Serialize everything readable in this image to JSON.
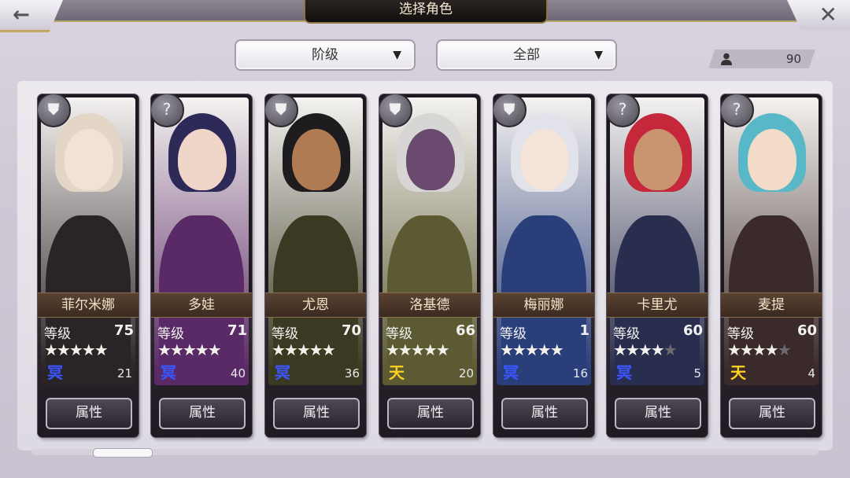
{
  "header": {
    "title": "选择角色",
    "back_icon": "←",
    "close_icon": "✕"
  },
  "filters": [
    {
      "label": "阶级",
      "caret": "▼"
    },
    {
      "label": "全部",
      "caret": "▼"
    }
  ],
  "roster_count": "90",
  "level_label": "等级",
  "attr_label": "属性",
  "characters": [
    {
      "name": "菲尔米娜",
      "level": "75",
      "stars": "★★★★★",
      "stars_off": "",
      "element": "冥",
      "element_color": "#3a56ff",
      "count": "21",
      "class_icon": "⛊",
      "hair": "#e3d6c6",
      "skin": "#f2e2d4",
      "outfit": "#2b2426"
    },
    {
      "name": "多娃",
      "level": "71",
      "stars": "★★★★★",
      "stars_off": "",
      "element": "冥",
      "element_color": "#3a56ff",
      "count": "40",
      "class_icon": "?",
      "hair": "#2e2a58",
      "skin": "#f0d6c8",
      "outfit": "#5a2a66"
    },
    {
      "name": "尤恩",
      "level": "70",
      "stars": "★★★★★",
      "stars_off": "",
      "element": "冥",
      "element_color": "#3a56ff",
      "count": "36",
      "class_icon": "⛊",
      "hair": "#1e1c1e",
      "skin": "#b07a52",
      "outfit": "#3a3a22"
    },
    {
      "name": "洛基德",
      "level": "66",
      "stars": "★★★★★",
      "stars_off": "",
      "element": "天",
      "element_color": "#ffd21e",
      "count": "20",
      "class_icon": "⛊",
      "hair": "#d8d6d4",
      "skin": "#6a4a6e",
      "outfit": "#5c5a32"
    },
    {
      "name": "梅丽娜",
      "level": "1",
      "stars": "★★★★★",
      "stars_off": "",
      "element": "冥",
      "element_color": "#3a56ff",
      "count": "16",
      "class_icon": "⛊",
      "hair": "#e2e2ea",
      "skin": "#f4e4da",
      "outfit": "#2a3e7a"
    },
    {
      "name": "卡里尤",
      "level": "60",
      "stars": "★★★★",
      "stars_off": "★",
      "element": "冥",
      "element_color": "#3a56ff",
      "count": "5",
      "class_icon": "?",
      "hair": "#c4283a",
      "skin": "#c99470",
      "outfit": "#2a2e4e"
    },
    {
      "name": "麦提",
      "level": "60",
      "stars": "★★★★",
      "stars_off": "★",
      "element": "天",
      "element_color": "#ffd21e",
      "count": "4",
      "class_icon": "?",
      "hair": "#58b8c8",
      "skin": "#f2dcc8",
      "outfit": "#3a2a2a"
    }
  ]
}
